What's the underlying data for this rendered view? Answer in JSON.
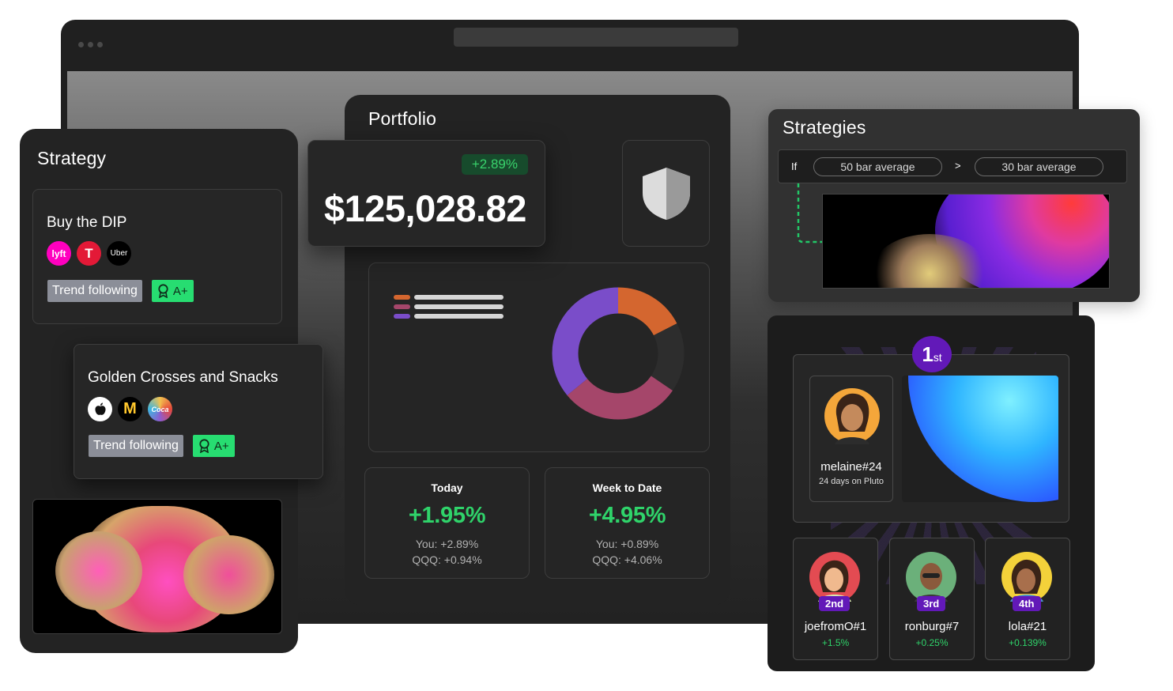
{
  "portfolio": {
    "title": "Portfolio",
    "change_badge": "+2.89%",
    "balance": "$125,028.82",
    "icons": {
      "shield": "shield-icon"
    },
    "allocation_colors": [
      "#d4662f",
      "#a5466a",
      "#7a4dc9"
    ],
    "today": {
      "label": "Today",
      "value": "+1.95%",
      "you": "You: +2.89%",
      "qqq": "QQQ: +0.94%"
    },
    "week": {
      "label": "Week to Date",
      "value": "+4.95%",
      "you": "You: +0.89%",
      "qqq": "QQQ: +4.06%"
    }
  },
  "strategy": {
    "title": "Strategy",
    "cards": [
      {
        "name": "Buy the DIP",
        "logos": [
          "Lyft",
          "Tesla",
          "Uber"
        ],
        "tag": "Trend following",
        "grade": "A+"
      },
      {
        "name": "Golden Crosses and Snacks",
        "logos": [
          "Apple",
          "McDonald's",
          "Coca-Cola"
        ],
        "tag": "Trend following",
        "grade": "A+"
      }
    ]
  },
  "strategies": {
    "title": "Strategies",
    "if_label": "If",
    "left_condition": "50 bar average",
    "operator": ">",
    "right_condition": "30 bar average"
  },
  "leaderboard": {
    "first": {
      "rank": "1",
      "suffix": "st",
      "name": "melaine#24",
      "detail": "24 days on Pluto"
    },
    "others": [
      {
        "rank": "2nd",
        "name": "joefromO#1",
        "gain": "+1.5%"
      },
      {
        "rank": "3rd",
        "name": "ronburg#7",
        "gain": "+0.25%"
      },
      {
        "rank": "4th",
        "name": "lola#21",
        "gain": "+0.139%"
      }
    ]
  },
  "colors": {
    "accent_green": "#2fd36a",
    "rank_purple": "#6219b8",
    "card_bg": "#252525"
  }
}
